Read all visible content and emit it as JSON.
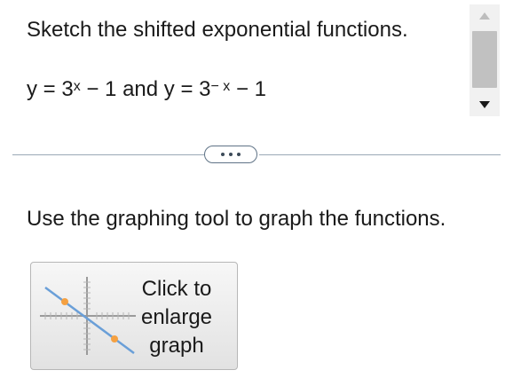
{
  "question": {
    "title": "Sketch the shifted exponential functions.",
    "equation": {
      "part1_prefix": "y = 3",
      "part1_exponent": "x",
      "part1_suffix": " − 1 and y = 3",
      "part2_exponent": "− x",
      "part2_suffix": " − 1"
    },
    "instruction": "Use the graphing tool to graph the functions."
  },
  "graph_button": {
    "label_line1": "Click to",
    "label_line2": "enlarge",
    "label_line3": "graph"
  },
  "colors": {
    "text": "#1a1a1a",
    "divider": "#9aa8b6",
    "line_blue": "#6a9fd8",
    "point_orange": "#f5a142",
    "scroll_thumb": "#c1c1c1"
  },
  "icons": {
    "scroll_up": "triangle-up",
    "scroll_down": "triangle-down",
    "more": "ellipsis"
  }
}
